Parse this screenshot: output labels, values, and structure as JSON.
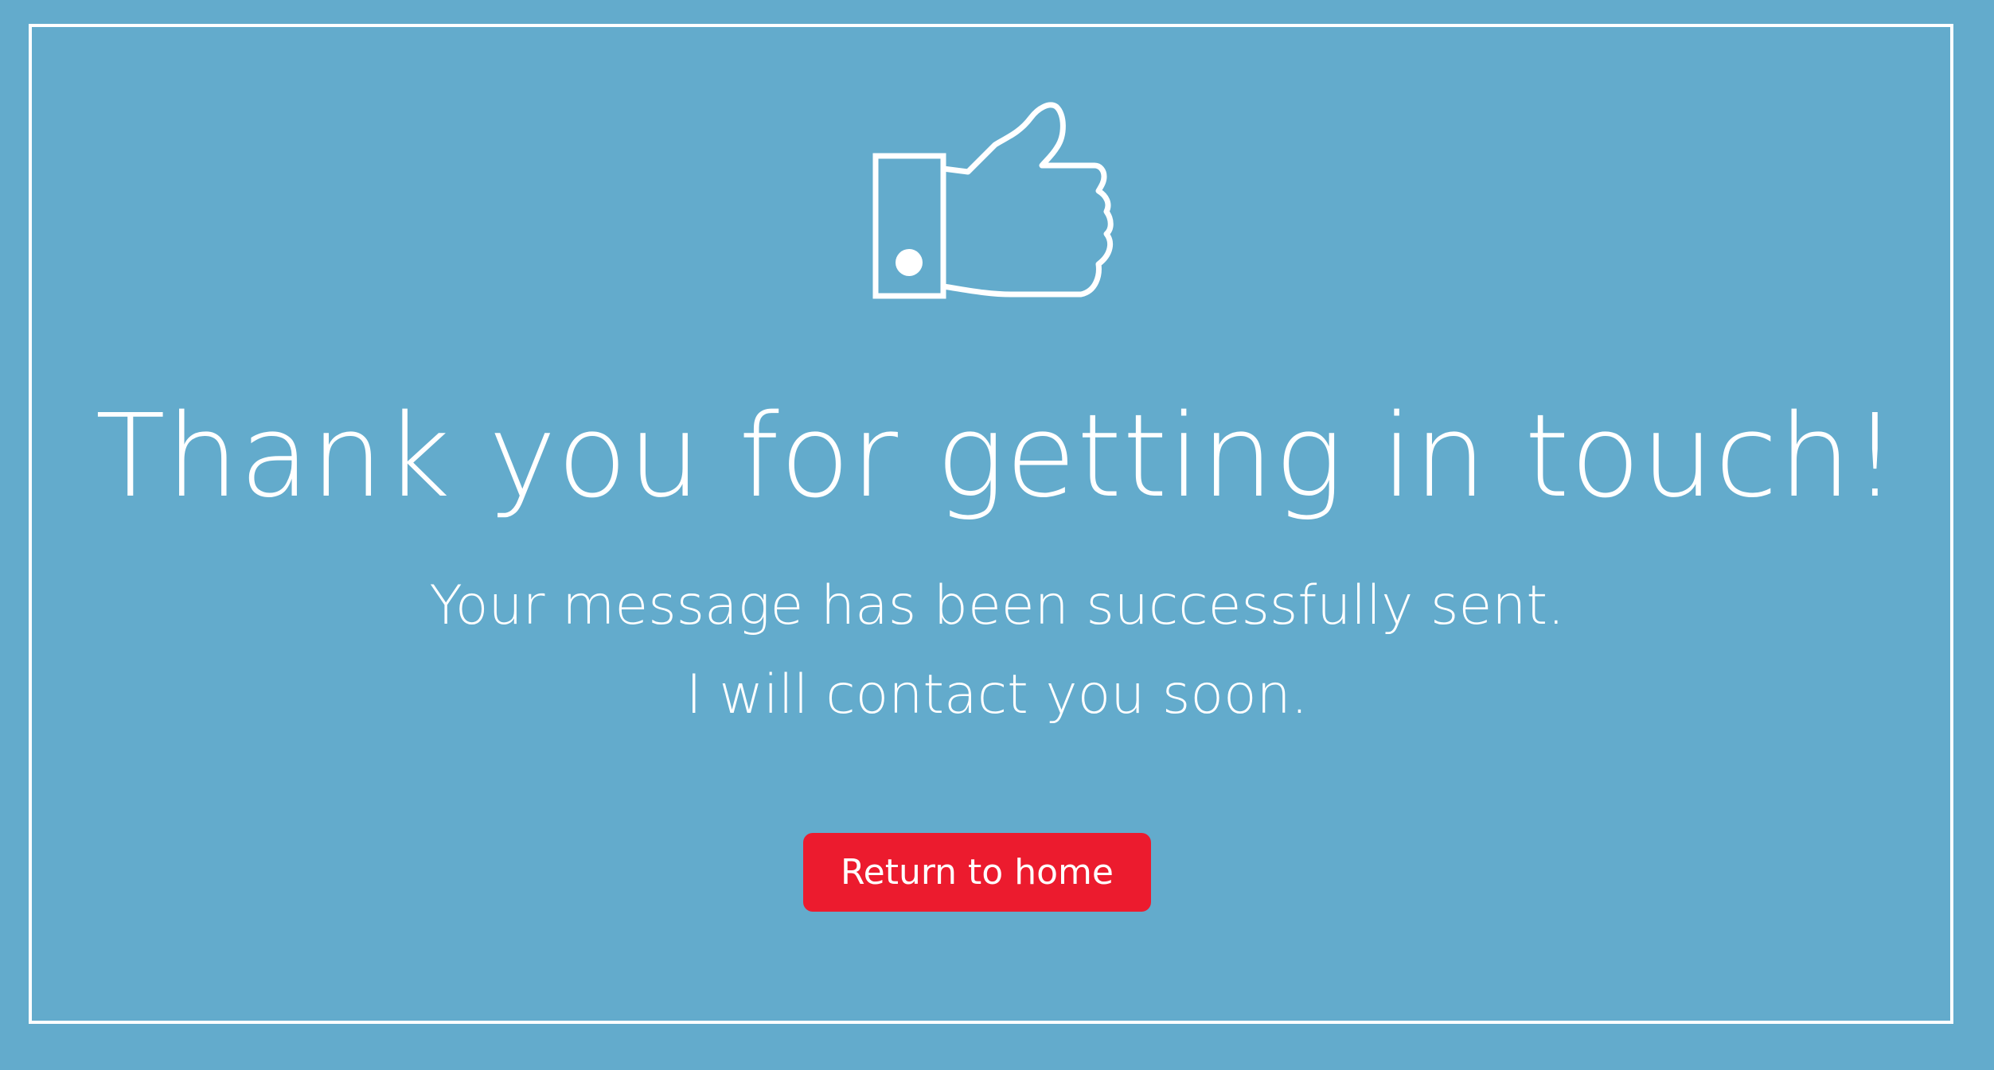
{
  "icon": "thumbs-up-icon",
  "headline": "Thank you for getting in touch!",
  "message": {
    "line1": "Your message has been successfully sent.",
    "line2": "I will contact you soon."
  },
  "button": {
    "label": "Return to home"
  },
  "colors": {
    "background": "#63abcc",
    "text": "#ffffff",
    "button": "#ec1b2e"
  }
}
